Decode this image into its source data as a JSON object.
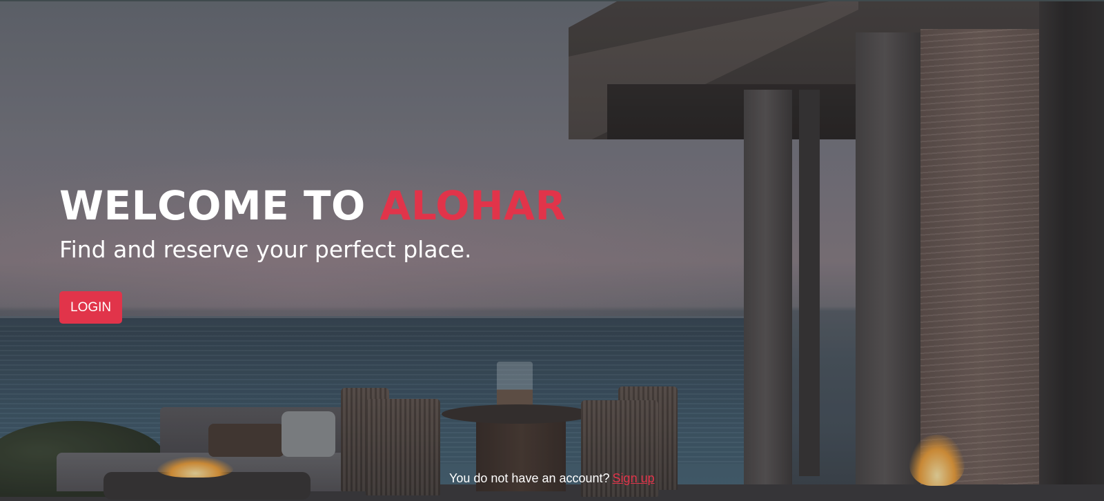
{
  "hero": {
    "headline_prefix": "WELCOME TO",
    "headline_brand": "ALOHAR",
    "subtitle": "Find and reserve your perfect place.",
    "login_label": "LOGIN"
  },
  "footer": {
    "prompt": "You do not have an account?",
    "signup_label": "Sign up"
  },
  "colors": {
    "accent": "#e1344a",
    "text": "#ffffff"
  }
}
